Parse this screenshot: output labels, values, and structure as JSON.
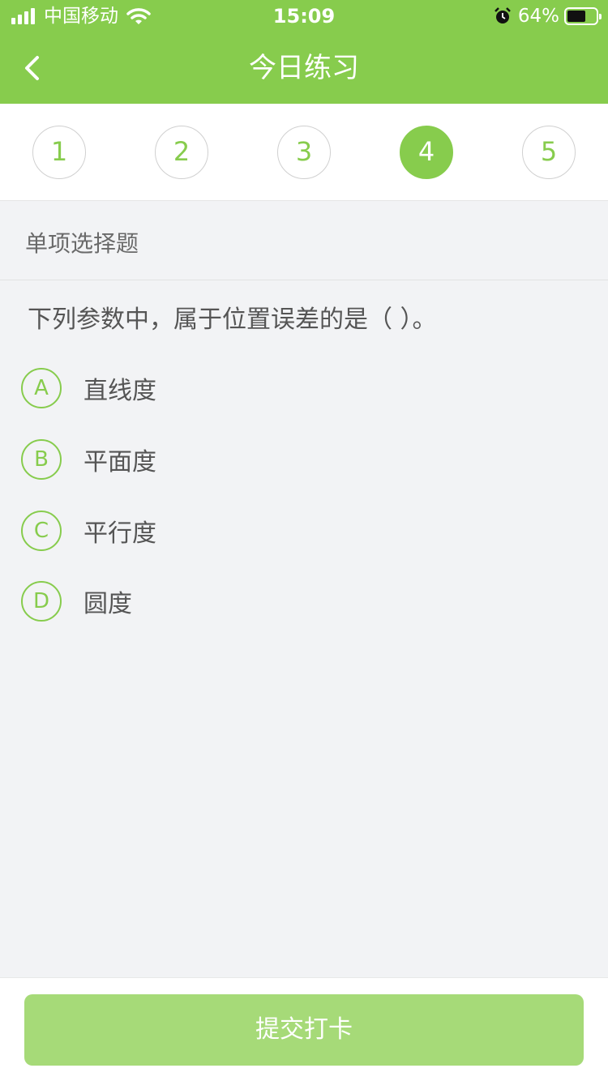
{
  "status_bar": {
    "carrier": "中国移动",
    "time": "15:09",
    "battery_percent": "64%",
    "battery_level": 0.64,
    "icons": [
      "signal-icon",
      "wifi-icon",
      "alarm-icon",
      "battery-icon"
    ]
  },
  "nav": {
    "title": "今日练习",
    "back_icon": "chevron-left-icon"
  },
  "steps": {
    "items": [
      "1",
      "2",
      "3",
      "4",
      "5"
    ],
    "active": "4"
  },
  "section": {
    "label": "单项选择题"
  },
  "question": {
    "text": "下列参数中，属于位置误差的是（    ）。",
    "options": [
      {
        "letter": "A",
        "text": "直线度"
      },
      {
        "letter": "B",
        "text": "平面度"
      },
      {
        "letter": "C",
        "text": "平行度"
      },
      {
        "letter": "D",
        "text": "圆度"
      }
    ]
  },
  "footer": {
    "submit_label": "提交打卡"
  },
  "colors": {
    "accent": "#87cc4d",
    "button_disabled": "#a6da78",
    "background": "#f2f3f5"
  }
}
